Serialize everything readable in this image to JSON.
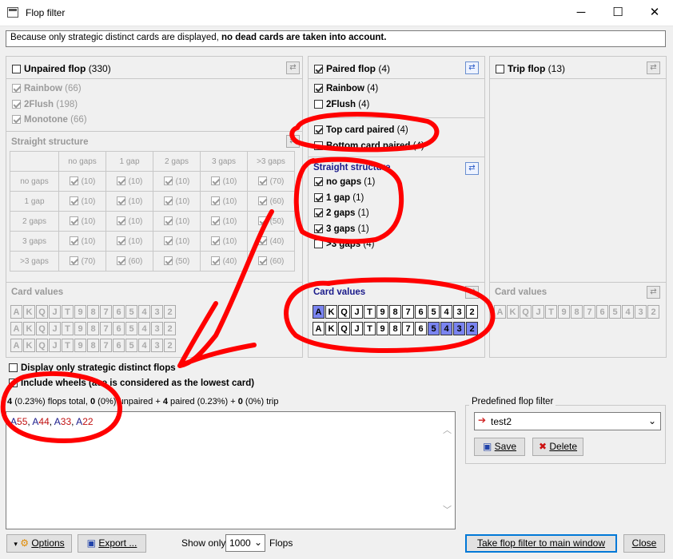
{
  "window": {
    "title": "Flop filter",
    "minimize": "─",
    "maximize": "☐",
    "close": "✕"
  },
  "info": {
    "text_plain": "Because only strategic distinct cards are displayed, ",
    "text_bold": "no dead cards are taken into account."
  },
  "unpaired": {
    "label": "Unpaired flop",
    "count": "(330)",
    "checked": false,
    "options": [
      {
        "label": "Rainbow",
        "count": "(66)"
      },
      {
        "label": "2Flush",
        "count": "(198)"
      },
      {
        "label": "Monotone",
        "count": "(66)"
      }
    ],
    "straight_title": "Straight structure",
    "columns": [
      "no gaps",
      "1 gap",
      "2 gaps",
      "3 gaps",
      ">3 gaps"
    ],
    "rows": [
      {
        "label": "no gaps",
        "cells": [
          "(10)",
          "(10)",
          "(10)",
          "(10)",
          "(70)"
        ]
      },
      {
        "label": "1 gap",
        "cells": [
          "(10)",
          "(10)",
          "(10)",
          "(10)",
          "(60)"
        ]
      },
      {
        "label": "2 gaps",
        "cells": [
          "(10)",
          "(10)",
          "(10)",
          "(10)",
          "(50)"
        ]
      },
      {
        "label": "3 gaps",
        "cells": [
          "(10)",
          "(10)",
          "(10)",
          "(10)",
          "(40)"
        ]
      },
      {
        "label": ">3 gaps",
        "cells": [
          "(70)",
          "(60)",
          "(50)",
          "(40)",
          "(60)"
        ]
      }
    ],
    "card_values_title": "Card values"
  },
  "paired": {
    "label": "Paired flop",
    "count": "(4)",
    "checked": true,
    "suits": [
      {
        "label": "Rainbow",
        "count": "(4)",
        "checked": true
      },
      {
        "label": "2Flush",
        "count": "(4)",
        "checked": false
      }
    ],
    "pair_pos": [
      {
        "label": "Top card paired",
        "count": "(4)",
        "checked": true
      },
      {
        "label": "Bottom card paired",
        "count": "(4)",
        "checked": false
      }
    ],
    "straight_title": "Straight structure",
    "straight": [
      {
        "label": "no gaps",
        "count": "(1)",
        "checked": true
      },
      {
        "label": "1 gap",
        "count": "(1)",
        "checked": true
      },
      {
        "label": "2 gaps",
        "count": "(1)",
        "checked": true
      },
      {
        "label": "3 gaps",
        "count": "(1)",
        "checked": true
      },
      {
        "label": ">3 gaps",
        "count": "(4)",
        "checked": false
      }
    ],
    "card_values_title": "Card values"
  },
  "trip": {
    "label": "Trip flop",
    "count": "(13)",
    "checked": false,
    "card_values_title": "Card values"
  },
  "card_ranks": [
    "A",
    "K",
    "Q",
    "J",
    "T",
    "9",
    "8",
    "7",
    "6",
    "5",
    "4",
    "3",
    "2"
  ],
  "paired_card_rows": [
    [
      "A"
    ],
    [
      "5",
      "4",
      "3",
      "2"
    ]
  ],
  "options": {
    "strategic_label": "Display only strategic distinct flops",
    "wheels_label": "Include wheels (ace is considered as the lowest card)"
  },
  "summary": {
    "total": "4",
    "total_pct": "(0.23%)",
    "flops_total": "flops total,",
    "unpaired": "0",
    "unpaired_pct": "(0%)",
    "unpaired_label": "unpaired +",
    "paired": "4",
    "paired_label": "paired (0.23%) +",
    "trip": "0",
    "trip_pct": "(0%)",
    "trip_label": "trip"
  },
  "results": [
    {
      "hi": "A",
      "lo": "55"
    },
    {
      "hi": "A",
      "lo": "44"
    },
    {
      "hi": "A",
      "lo": "33"
    },
    {
      "hi": "A",
      "lo": "22"
    }
  ],
  "predefined": {
    "title": "Predefined flop filter",
    "selected": "test2",
    "save": "Save",
    "delete": "Delete"
  },
  "footer": {
    "options": "Options",
    "export": "Export ...",
    "show_only": "Show only",
    "show_value": "1000",
    "flops": "Flops",
    "take": "Take flop filter to main window",
    "close": "Close"
  },
  "colors": {
    "accent": "#0078d7",
    "selected_card": "#7a84f0",
    "annotation": "#ff0000",
    "link_blue": "#1a1a8a"
  }
}
